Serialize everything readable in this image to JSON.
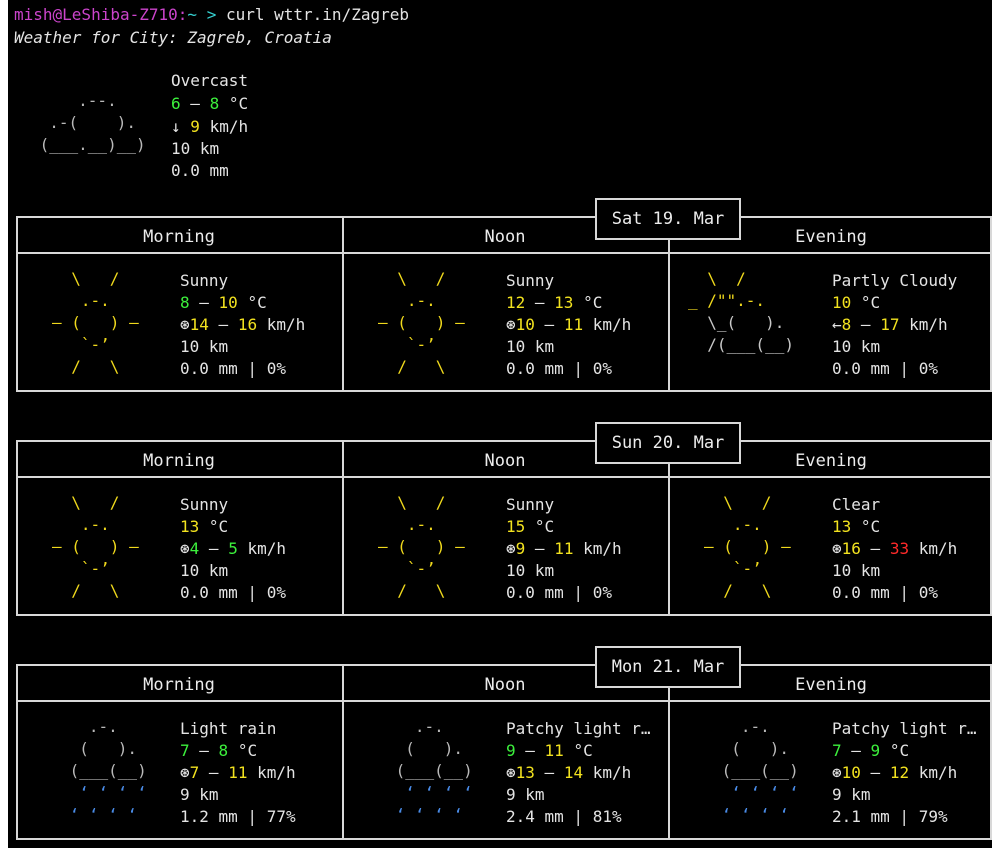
{
  "prompt": {
    "user": "mish@LeShiba-Z710",
    "path": "~",
    "symbol": ">",
    "command": "curl wttr.in/Zagreb"
  },
  "subtitle": "Weather for City: Zagreb, Croatia",
  "current": {
    "desc": "Overcast",
    "t1": "6",
    "dash": "–",
    "t2": "8",
    "unit": "°C",
    "wind_arrow": "↓",
    "wind": "9",
    "wind_unit": "km/h",
    "visibility": "10 km",
    "precip": "0.0 mm"
  },
  "days": [
    {
      "date": "Sat 19. Mar",
      "periods": [
        {
          "label": "Morning",
          "desc": "Sunny",
          "t1": "8",
          "t2": "10",
          "unit": "°C",
          "wa": "⊛",
          "w1": "14",
          "w2": "16",
          "wu": "km/h",
          "vis": "10 km",
          "precip": "0.0 mm | 0%"
        },
        {
          "label": "Noon",
          "desc": "Sunny",
          "t1": "12",
          "t2": "13",
          "unit": "°C",
          "wa": "⊛",
          "w1": "10",
          "w2": "11",
          "wu": "km/h",
          "vis": "10 km",
          "precip": "0.0 mm | 0%"
        },
        {
          "label": "Evening",
          "desc": "Partly Cloudy",
          "t1": "10",
          "t2": "",
          "unit": "°C",
          "wa": "←",
          "w1": "8",
          "w2": "17",
          "wu": "km/h",
          "vis": "10 km",
          "precip": "0.0 mm | 0%"
        }
      ]
    },
    {
      "date": "Sun 20. Mar",
      "periods": [
        {
          "label": "Morning",
          "desc": "Sunny",
          "t1": "13",
          "t2": "",
          "unit": "°C",
          "wa": "⊛",
          "w1": "4",
          "w2": "5",
          "wu": "km/h",
          "vis": "10 km",
          "precip": "0.0 mm | 0%"
        },
        {
          "label": "Noon",
          "desc": "Sunny",
          "t1": "15",
          "t2": "",
          "unit": "°C",
          "wa": "⊛",
          "w1": "9",
          "w2": "11",
          "wu": "km/h",
          "vis": "10 km",
          "precip": "0.0 mm | 0%"
        },
        {
          "label": "Evening",
          "desc": "Clear",
          "t1": "13",
          "t2": "",
          "unit": "°C",
          "wa": "⊛",
          "w1": "16",
          "w2": "33",
          "wu": "km/h",
          "vis": "10 km",
          "precip": "0.0 mm | 0%"
        }
      ]
    },
    {
      "date": "Mon 21. Mar",
      "periods": [
        {
          "label": "Morning",
          "desc": "Light rain",
          "t1": "7",
          "t2": "8",
          "unit": "°C",
          "wa": "⊛",
          "w1": "7",
          "w2": "11",
          "wu": "km/h",
          "vis": "9 km",
          "precip": "1.2 mm | 77%"
        },
        {
          "label": "Noon",
          "desc": "Patchy light r…",
          "t1": "9",
          "t2": "11",
          "unit": "°C",
          "wa": "⊛",
          "w1": "13",
          "w2": "14",
          "wu": "km/h",
          "vis": "9 km",
          "precip": "2.4 mm | 81%"
        },
        {
          "label": "Evening",
          "desc": "Patchy light r…",
          "t1": "7",
          "t2": "9",
          "unit": "°C",
          "wa": "⊛",
          "w1": "10",
          "w2": "12",
          "wu": "km/h",
          "vis": "9 km",
          "precip": "2.1 mm | 79%"
        }
      ]
    }
  ],
  "art": {
    "cloud": "     .--.    \n  .-(    ).  \n (___.__)__) ",
    "sun_top": "  \\   /  ",
    "sun_mid1": "   .-.   ",
    "sun_mid2": "― (   ) ―",
    "sun_mid3": "   `-’   ",
    "sun_bot": "  /   \\  ",
    "partly": "  \\  /      \n_ /\"\".-.   \n  \\_(   ).  \n  /(___(__) ",
    "rain_cloud": "   .-.    \n  (   ).  \n (___(__) ",
    "rain_drops": "  ‘ ‘ ‘ ‘ \n ‘ ‘ ‘ ‘  "
  }
}
